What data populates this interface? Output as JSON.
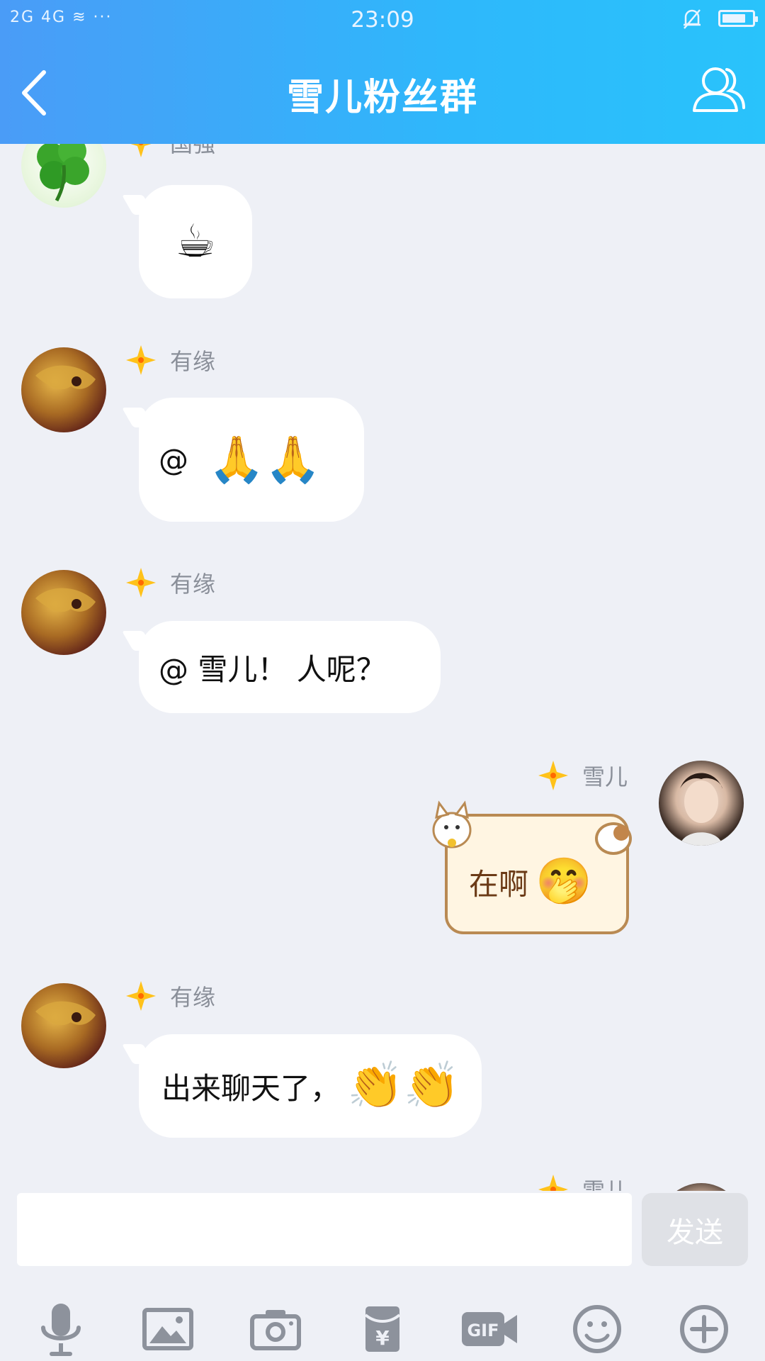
{
  "status_bar": {
    "signal_text": "2G 4G",
    "time": "23:09"
  },
  "header": {
    "title": "雪儿粉丝群"
  },
  "messages": [
    {
      "sender": "国强",
      "emoji": "☕"
    },
    {
      "sender": "有缘",
      "text": "@",
      "emoji": "🙏🙏"
    },
    {
      "sender": "有缘",
      "text": "@ 雪儿！ 人呢？"
    },
    {
      "sender": "雪儿",
      "text": "在啊",
      "emoji": "🤭"
    },
    {
      "sender": "有缘",
      "text": "出来聊天了，",
      "emoji": "👏👏"
    },
    {
      "sender": "雪儿"
    }
  ],
  "composer": {
    "placeholder": "",
    "send_label": "发送"
  },
  "toolbar": [
    "voice",
    "image",
    "camera",
    "red-packet",
    "gif",
    "emoji",
    "plus"
  ],
  "colors": {
    "header_start": "#4a9cf7",
    "header_end": "#29c3fb",
    "background": "#eef0f6"
  }
}
